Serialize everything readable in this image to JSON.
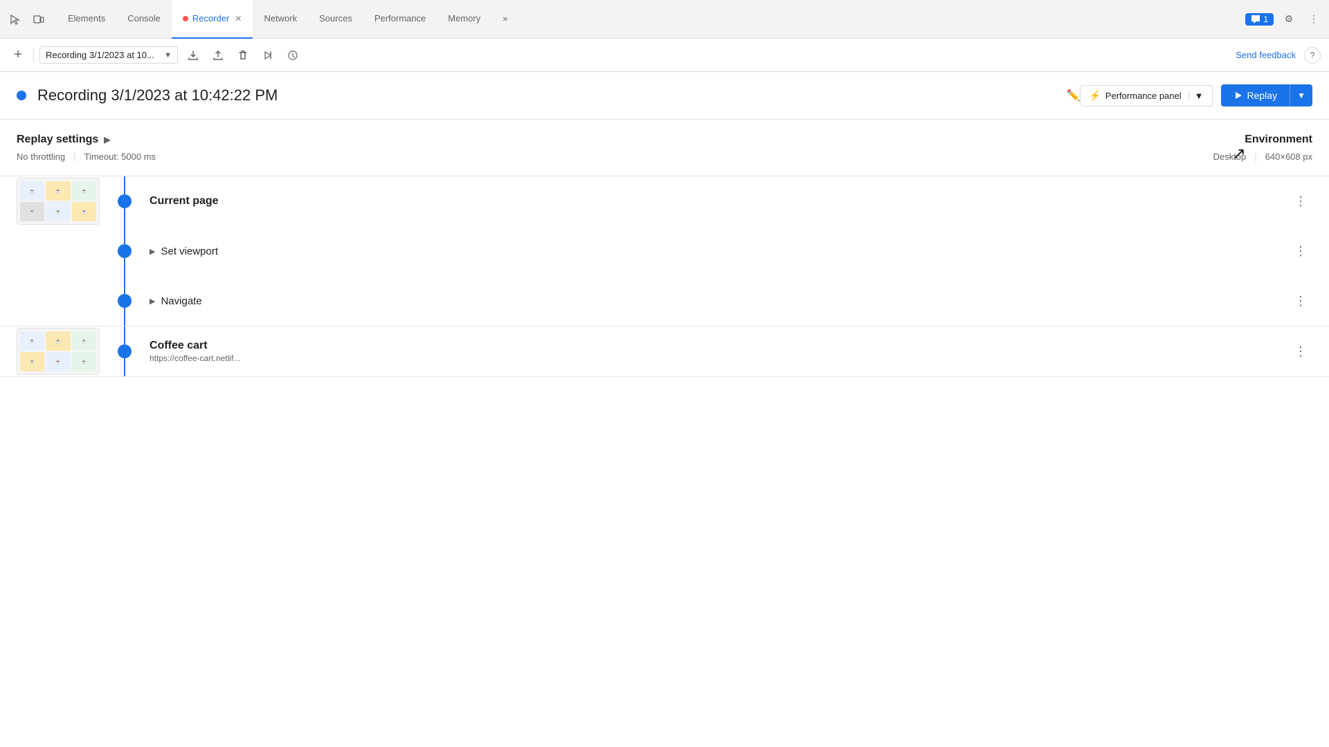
{
  "tabs": {
    "items": [
      {
        "label": "Elements",
        "active": false,
        "id": "elements"
      },
      {
        "label": "Console",
        "active": false,
        "id": "console"
      },
      {
        "label": "Recorder",
        "active": true,
        "id": "recorder",
        "has_close": true,
        "has_dot": true
      },
      {
        "label": "Network",
        "active": false,
        "id": "network"
      },
      {
        "label": "Sources",
        "active": false,
        "id": "sources"
      },
      {
        "label": "Performance",
        "active": false,
        "id": "performance"
      },
      {
        "label": "Memory",
        "active": false,
        "id": "memory"
      }
    ],
    "more_label": "»",
    "comment_badge": "1",
    "gear_label": "⚙",
    "ellipsis_label": "⋮"
  },
  "toolbar": {
    "add_label": "+",
    "recording_name": "Recording 3/1/2023 at 10...",
    "send_feedback_label": "Send feedback",
    "help_label": "?"
  },
  "recording": {
    "title": "Recording 3/1/2023 at 10:42:22 PM",
    "perf_panel_label": "Performance panel",
    "replay_label": "Replay"
  },
  "replay_settings": {
    "title": "Replay settings",
    "throttling": "No throttling",
    "timeout": "Timeout: 5000 ms",
    "environment_title": "Environment",
    "device": "Desktop",
    "resolution": "640×608 px"
  },
  "steps": {
    "groups": [
      {
        "id": "group-1",
        "title": "Current page",
        "steps": [
          {
            "id": "step-1",
            "label": "Set viewport",
            "expandable": true
          },
          {
            "id": "step-2",
            "label": "Navigate",
            "expandable": true
          }
        ]
      },
      {
        "id": "group-2",
        "title": "Coffee cart",
        "subtitle": "https://coffee-cart.netlif...",
        "steps": []
      }
    ]
  },
  "colors": {
    "accent": "#1a73e8",
    "text_primary": "#202124",
    "text_secondary": "#5f6368",
    "border": "#d8d8d8",
    "bg_tab_active": "#ffffff",
    "bg_tab_bar": "#f3f3f3"
  }
}
